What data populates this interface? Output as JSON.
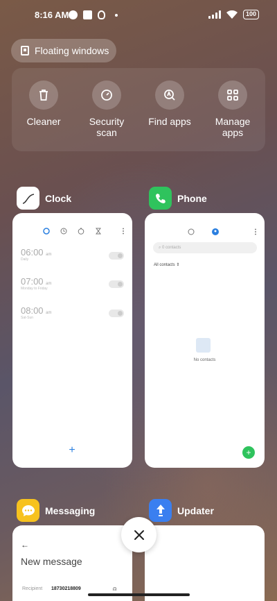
{
  "status_bar": {
    "time": "8:16 AM",
    "battery": "100"
  },
  "floating_windows": {
    "label": "Floating windows"
  },
  "quick_actions": [
    {
      "label": "Cleaner",
      "icon": "trash-icon"
    },
    {
      "label": "Security\nscan",
      "icon": "gauge-icon"
    },
    {
      "label": "Find apps",
      "icon": "find-apps-icon"
    },
    {
      "label": "Manage\napps",
      "icon": "grid-icon"
    }
  ],
  "apps": {
    "clock": {
      "name": "Clock",
      "alarms": [
        {
          "time": "06:00",
          "ampm": "am",
          "sub": "Daily"
        },
        {
          "time": "07:00",
          "ampm": "am",
          "sub": "Monday to Friday"
        },
        {
          "time": "08:00",
          "ampm": "am",
          "sub": "Sat-Sun"
        }
      ]
    },
    "phone": {
      "name": "Phone",
      "search_placeholder": "0 contacts",
      "filter": "All contacts",
      "empty": "No contacts"
    },
    "messaging": {
      "name": "Messaging",
      "title": "New message",
      "recipient_label": "Recipient",
      "recipient_value": "18730218809"
    },
    "updater": {
      "name": "Updater"
    }
  },
  "colors": {
    "phone_green": "#2fc35d",
    "messaging_yellow": "#f7c21e",
    "updater_blue": "#3a7ff0",
    "clock_accent": "#2a7fe0"
  }
}
